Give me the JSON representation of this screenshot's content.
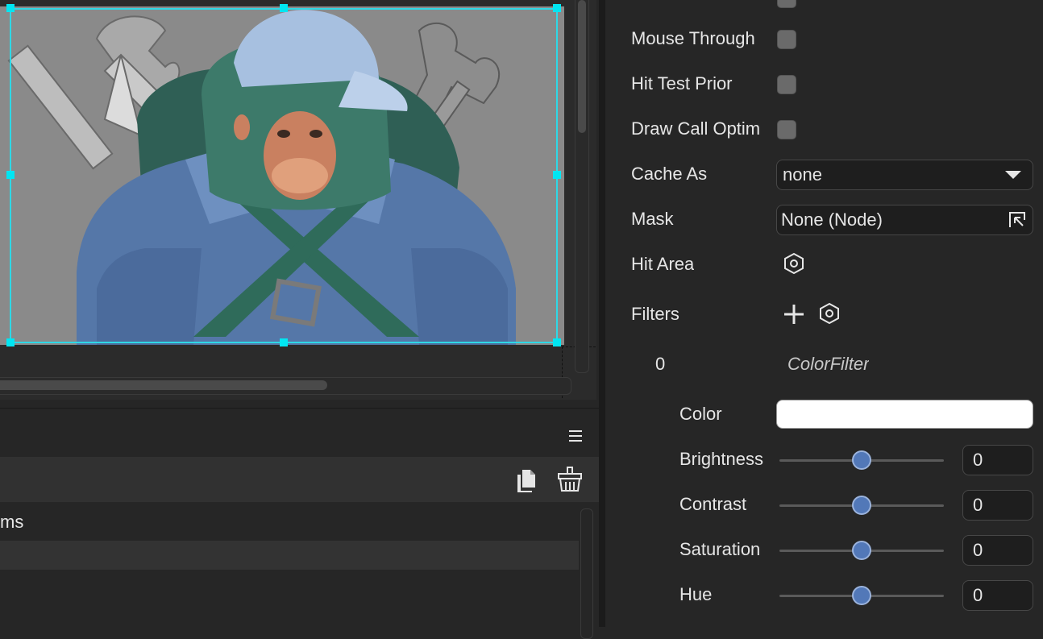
{
  "inspector": {
    "properties": [
      {
        "label": "Mouse Through",
        "type": "checkbox",
        "checked": false
      },
      {
        "label": "Hit Test Prior",
        "type": "checkbox",
        "checked": false
      },
      {
        "label": "Draw Call Optim",
        "type": "checkbox",
        "checked": false
      }
    ],
    "cache_as": {
      "label": "Cache As",
      "value": "none"
    },
    "mask": {
      "label": "Mask",
      "value": "None (Node)"
    },
    "hit_area": {
      "label": "Hit Area"
    },
    "filters": {
      "label": "Filters"
    },
    "filter_item": {
      "index": "0",
      "type": "ColorFilter"
    },
    "color": {
      "label": "Color",
      "value": "#ffffff"
    },
    "sliders": [
      {
        "label": "Brightness",
        "value": "0",
        "fraction": 0.5
      },
      {
        "label": "Contrast",
        "value": "0",
        "fraction": 0.5
      },
      {
        "label": "Saturation",
        "value": "0",
        "fraction": 0.5
      },
      {
        "label": "Hue",
        "value": "0",
        "fraction": 0.5
      }
    ]
  },
  "bottom_panel": {
    "partial_item_text": "ms",
    "icons": [
      "menu-icon",
      "copy-icon",
      "clear-icon"
    ]
  },
  "colors": {
    "selection": "#2fd8e6",
    "slider_thumb": "#5278b8",
    "panel_bg": "#262626"
  }
}
